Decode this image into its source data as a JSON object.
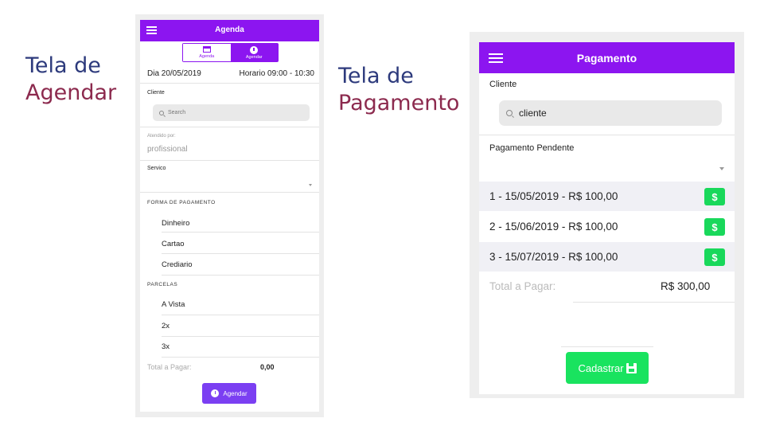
{
  "labels": {
    "agendar": {
      "line1": "Tela de",
      "line2": "Agendar"
    },
    "pagamento": {
      "line1": "Tela de",
      "line2": "Pagamento"
    }
  },
  "agenda_screen": {
    "header_title": "Agenda",
    "tabs": [
      {
        "label": "Agenda",
        "icon": "calendar-icon",
        "active": false
      },
      {
        "label": "Agendar",
        "icon": "clock-icon",
        "active": true
      }
    ],
    "date": "Dia 20/05/2019",
    "time": "Horario 09:00 - 10:30",
    "cliente_label": "Cliente",
    "search_placeholder": "Search",
    "atendido_label": "Atendido por:",
    "atendido_value": "profissional",
    "servico_label": "Servico",
    "forma_pagamento_header": "FORMA DE PAGAMENTO",
    "formas_pagamento": [
      "Dinheiro",
      "Cartao",
      "Crediario"
    ],
    "parcelas_header": "PARCELAS",
    "parcelas": [
      "A Vista",
      "2x",
      "3x"
    ],
    "total_label": "Total a Pagar:",
    "total_value": "0,00",
    "agendar_button": "Agendar"
  },
  "pagamento_screen": {
    "header_title": "Pagamento",
    "cliente_label": "Cliente",
    "search_value": "cliente",
    "pendente_label": "Pagamento Pendente",
    "parcelas": [
      {
        "text": "1 - 15/05/2019 - R$ 100,00"
      },
      {
        "text": "2 - 15/06/2019 - R$ 100,00"
      },
      {
        "text": "3 - 15/07/2019 - R$ 100,00"
      }
    ],
    "pay_button_symbol": "$",
    "total_label": "Total a Pagar:",
    "total_value": "R$ 300,00",
    "cadastrar_button": "Cadastrar"
  },
  "colors": {
    "accent": "#8c15f0",
    "button_purple": "#7b3ff2",
    "success_green": "#19d85b",
    "label_blue": "#2d3a7c",
    "label_maroon": "#8c2a4e"
  }
}
